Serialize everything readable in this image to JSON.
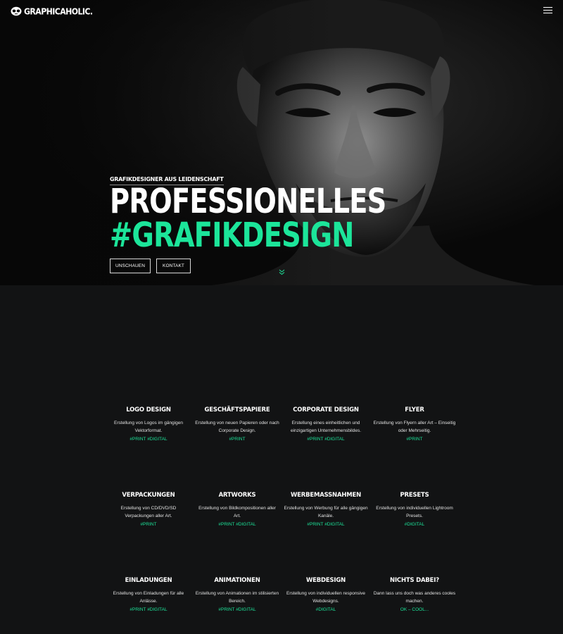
{
  "header": {
    "logo_text": "GRAPHICAHOLIC.",
    "menu_icon": "hamburger-menu-icon"
  },
  "hero": {
    "eyebrow": "GRAFIKDESIGNER AUS LEIDENSCHAFT",
    "headline_line1": "PROFESSIONELLES",
    "headline_line2": "#GRAFIKDESIGN",
    "buttons": {
      "look": "UNSCHAUEN",
      "contact": "KONTAKT"
    },
    "scroll_icon": "double-chevron-down-icon",
    "accent_color": "#1ce59a"
  },
  "services": [
    {
      "title": "LOGO DESIGN",
      "description": "Erstellung von Logos im gängigen Vektorformat.",
      "tags": "#PRINT #DIGITAL"
    },
    {
      "title": "GESCHÄFTSPAPIERE",
      "description": "Erstellung von neuen Papieren oder nach Corporate Design.",
      "tags": "#PRINT"
    },
    {
      "title": "CORPORATE DESIGN",
      "description": "Erstellung eines einheitlichen und einzigartigen Unternehmensbildes.",
      "tags": "#PRINT #DIGITAL"
    },
    {
      "title": "FLYER",
      "description": "Erstellung von Flyern aller Art – Einseitig oder Mehrseitig.",
      "tags": "#PRINT"
    },
    {
      "title": "VERPACKUNGEN",
      "description": "Erstellung von CD/DVD/SD Verpackungen aller Art.",
      "tags": "#PRINT"
    },
    {
      "title": "ARTWORKS",
      "description": "Erstellung von Bildkompositionen aller Art.",
      "tags": "#PRINT #DIGITAL"
    },
    {
      "title": "WERBEMASSNAHMEN",
      "description": "Erstellung von Werbung für alle gängigen Kanäle.",
      "tags": "#PRINT #DIGITAL"
    },
    {
      "title": "PRESETS",
      "description": "Erstellung von individuellen Lightroom Presets.",
      "tags": "#DIGITAL"
    },
    {
      "title": "EINLADUNGEN",
      "description": "Erstellung von Einladungen für alle Anlässe.",
      "tags": "#PRINT #DIGITAL"
    },
    {
      "title": "ANIMATIONEN",
      "description": "Erstellung von Animationen im stilisierten Bereich.",
      "tags": "#PRINT #DIGITAL"
    },
    {
      "title": "WEBDESIGN",
      "description": "Erstellung von individuellen responsive Webdesigns.",
      "tags": "#DIGITAL"
    },
    {
      "title": "NICHTS DABEI?",
      "description": "Dann lass uns doch was anderes cooles machen.",
      "tags": "OK – COOL..."
    }
  ]
}
